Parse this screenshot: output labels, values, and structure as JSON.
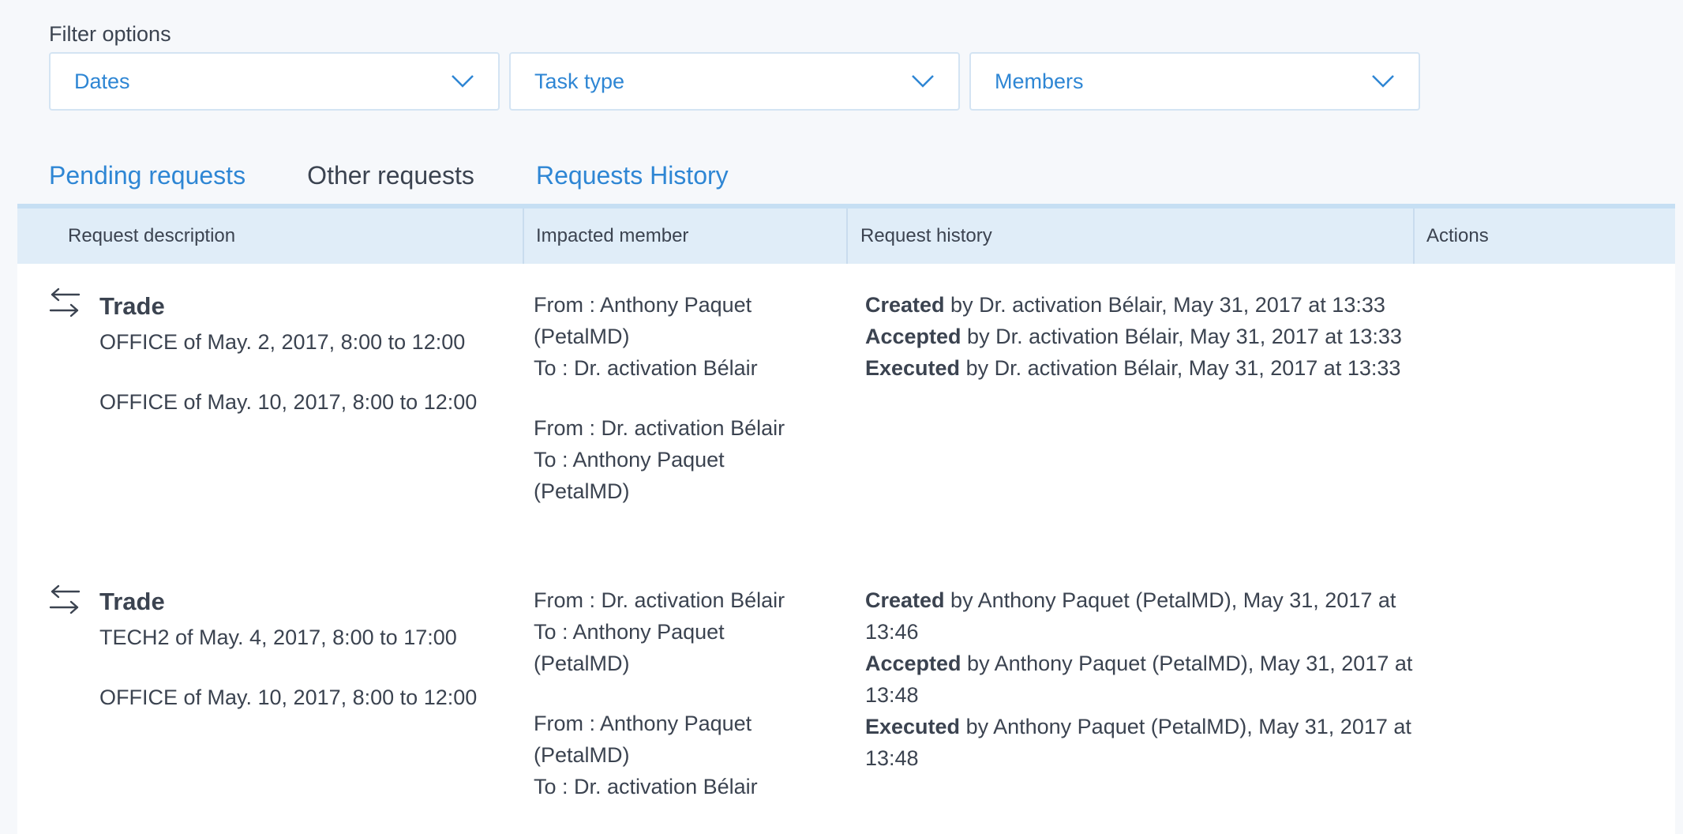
{
  "filters": {
    "label": "Filter options",
    "dates": "Dates",
    "task_type": "Task type",
    "members": "Members"
  },
  "tabs": [
    {
      "label": "Pending requests",
      "active": false
    },
    {
      "label": "Other requests",
      "active": true
    },
    {
      "label": "Requests History",
      "active": false
    }
  ],
  "table": {
    "columns": [
      "Request description",
      "Impacted member",
      "Request history",
      "Actions"
    ],
    "rows": [
      {
        "icon": "trade-arrows-icon",
        "title": "Trade",
        "shifts": [
          "OFFICE of May. 2, 2017, 8:00 to 12:00",
          "OFFICE of May. 10, 2017, 8:00 to 12:00"
        ],
        "members": [
          {
            "from": "From : Anthony Paquet (PetalMD)",
            "to": "To : Dr. activation Bélair"
          },
          {
            "from": "From : Dr. activation Bélair",
            "to": "To : Anthony Paquet (PetalMD)"
          }
        ],
        "history": [
          {
            "action": "Created",
            "text": " by Dr. activation Bélair, May 31, 2017 at 13:33"
          },
          {
            "action": "Accepted",
            "text": " by Dr. activation Bélair, May 31, 2017 at 13:33"
          },
          {
            "action": "Executed",
            "text": " by Dr. activation Bélair, May 31, 2017 at 13:33"
          }
        ]
      },
      {
        "icon": "trade-arrows-icon",
        "title": "Trade",
        "shifts": [
          "TECH2 of May. 4, 2017, 8:00 to 17:00",
          "OFFICE of May. 10, 2017, 8:00 to 12:00"
        ],
        "members": [
          {
            "from": "From : Dr. activation Bélair",
            "to": "To : Anthony Paquet (PetalMD)"
          },
          {
            "from": "From : Anthony Paquet (PetalMD)",
            "to": "To : Dr. activation Bélair"
          }
        ],
        "history": [
          {
            "action": "Created",
            "text": " by Anthony Paquet (PetalMD), May 31, 2017 at 13:46"
          },
          {
            "action": "Accepted",
            "text": " by Anthony Paquet (PetalMD), May 31, 2017 at 13:48"
          },
          {
            "action": "Executed",
            "text": " by Anthony Paquet (PetalMD), May 31, 2017 at 13:48"
          }
        ]
      }
    ]
  },
  "colors": {
    "accent": "#2e86d4",
    "tab_indicator": "#3a66c6",
    "header_bg": "#e0edf8",
    "text": "#3b4350"
  }
}
